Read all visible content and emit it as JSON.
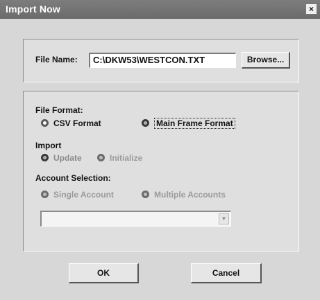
{
  "window": {
    "title": "Import Now",
    "close_glyph": "×"
  },
  "file_section": {
    "label": "File Name:",
    "value": "C:\\DKW53\\WESTCON.TXT",
    "browse_label": "Browse..."
  },
  "file_format": {
    "label": "File Format:",
    "options": [
      "CSV Format",
      "Main Frame Format"
    ],
    "selected": "Main Frame Format"
  },
  "import": {
    "label": "Import",
    "options": [
      "Update",
      "Initialize"
    ],
    "selected": "Update"
  },
  "account_selection": {
    "label": "Account Selection:",
    "options": [
      "Single Account",
      "Multiple Accounts"
    ],
    "selected": "Single Account"
  },
  "account_combo": {
    "value": ""
  },
  "buttons": {
    "ok_label": "OK",
    "cancel_label": "Cancel"
  },
  "icons": {
    "combo_arrow": "chevron-down-icon",
    "close": "close-icon"
  }
}
